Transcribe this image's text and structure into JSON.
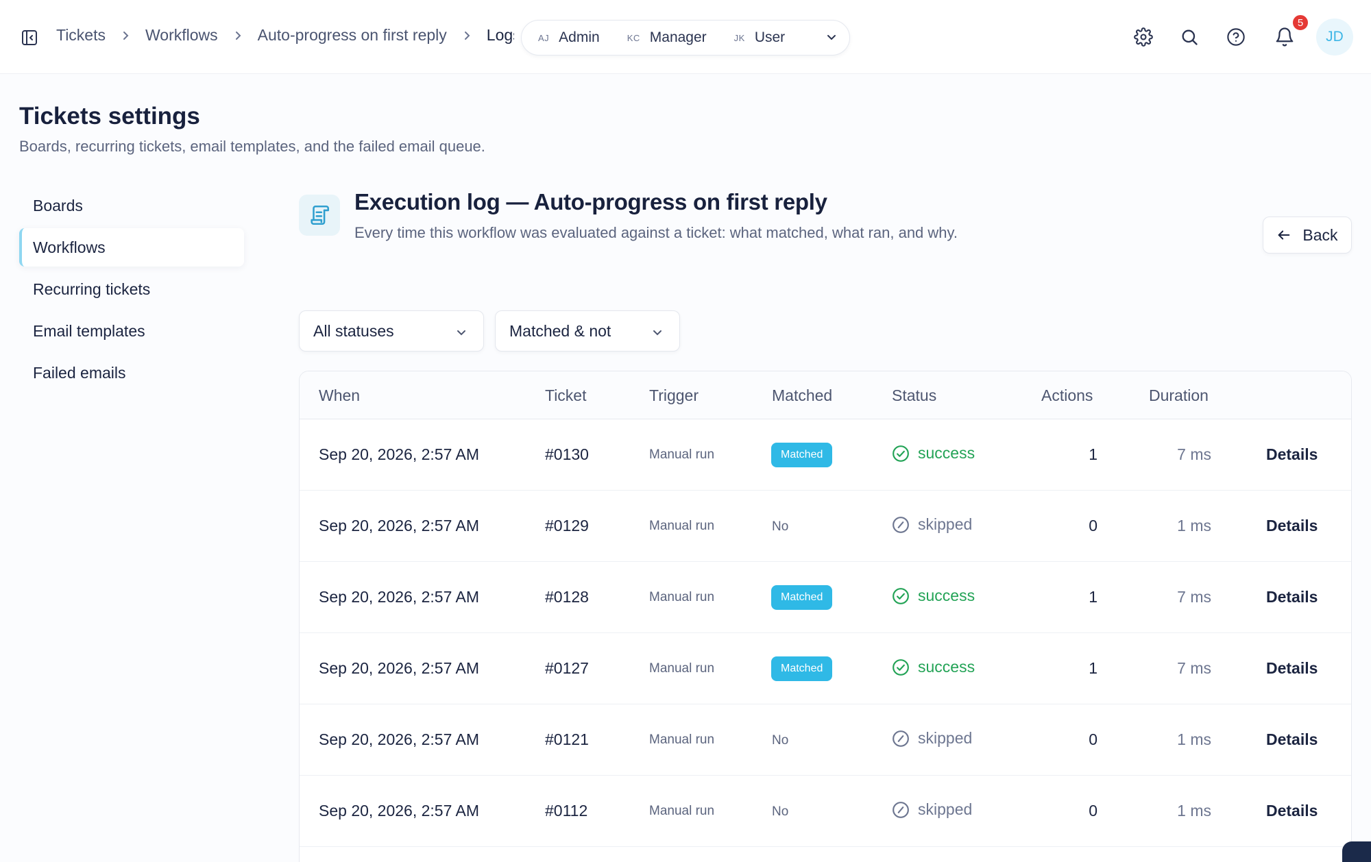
{
  "breadcrumb": {
    "items": [
      "Tickets",
      "Workflows",
      "Auto-progress on first reply"
    ],
    "current": "Logs"
  },
  "roles": [
    {
      "initials": "AJ",
      "name": "Admin"
    },
    {
      "initials": "KC",
      "name": "Manager"
    },
    {
      "initials": "JK",
      "name": "User"
    }
  ],
  "notifications": {
    "count": "5"
  },
  "user": {
    "initials": "JD"
  },
  "page": {
    "title": "Tickets settings",
    "subtitle": "Boards, recurring tickets, email templates, and the failed email queue."
  },
  "nav": {
    "items": [
      "Boards",
      "Workflows",
      "Recurring tickets",
      "Email templates",
      "Failed emails"
    ],
    "active": "Workflows"
  },
  "log": {
    "title": "Execution log — Auto-progress on first reply",
    "subtitle": "Every time this workflow was evaluated against a ticket: what matched, what ran, and why.",
    "back_label": "Back"
  },
  "filters": {
    "status": "All statuses",
    "matched": "Matched & not"
  },
  "table": {
    "headers": {
      "when": "When",
      "ticket": "Ticket",
      "trigger": "Trigger",
      "matched": "Matched",
      "status": "Status",
      "actions": "Actions",
      "duration": "Duration"
    },
    "details_label": "Details",
    "rows": [
      {
        "when": "Sep 20, 2026, 2:57 AM",
        "ticket": "#0130",
        "trigger": "Manual run",
        "matched": "Matched",
        "status": "success",
        "actions": "1",
        "duration": "7 ms"
      },
      {
        "when": "Sep 20, 2026, 2:57 AM",
        "ticket": "#0129",
        "trigger": "Manual run",
        "matched": "No",
        "status": "skipped",
        "actions": "0",
        "duration": "1 ms"
      },
      {
        "when": "Sep 20, 2026, 2:57 AM",
        "ticket": "#0128",
        "trigger": "Manual run",
        "matched": "Matched",
        "status": "success",
        "actions": "1",
        "duration": "7 ms"
      },
      {
        "when": "Sep 20, 2026, 2:57 AM",
        "ticket": "#0127",
        "trigger": "Manual run",
        "matched": "Matched",
        "status": "success",
        "actions": "1",
        "duration": "7 ms"
      },
      {
        "when": "Sep 20, 2026, 2:57 AM",
        "ticket": "#0121",
        "trigger": "Manual run",
        "matched": "No",
        "status": "skipped",
        "actions": "0",
        "duration": "1 ms"
      },
      {
        "when": "Sep 20, 2026, 2:57 AM",
        "ticket": "#0112",
        "trigger": "Manual run",
        "matched": "No",
        "status": "skipped",
        "actions": "0",
        "duration": "1 ms"
      }
    ]
  },
  "colors": {
    "accent": "#2fb9e6",
    "success": "#23a356",
    "skipped": "#6d7690",
    "notification": "#e53935"
  },
  "icons": [
    "sidebar-toggle-icon",
    "chevron-right-icon",
    "chevron-down-icon",
    "gear-icon",
    "search-icon",
    "help-icon",
    "bell-icon",
    "scroll-icon",
    "arrow-left-icon",
    "check-circle-icon",
    "slash-circle-icon"
  ]
}
